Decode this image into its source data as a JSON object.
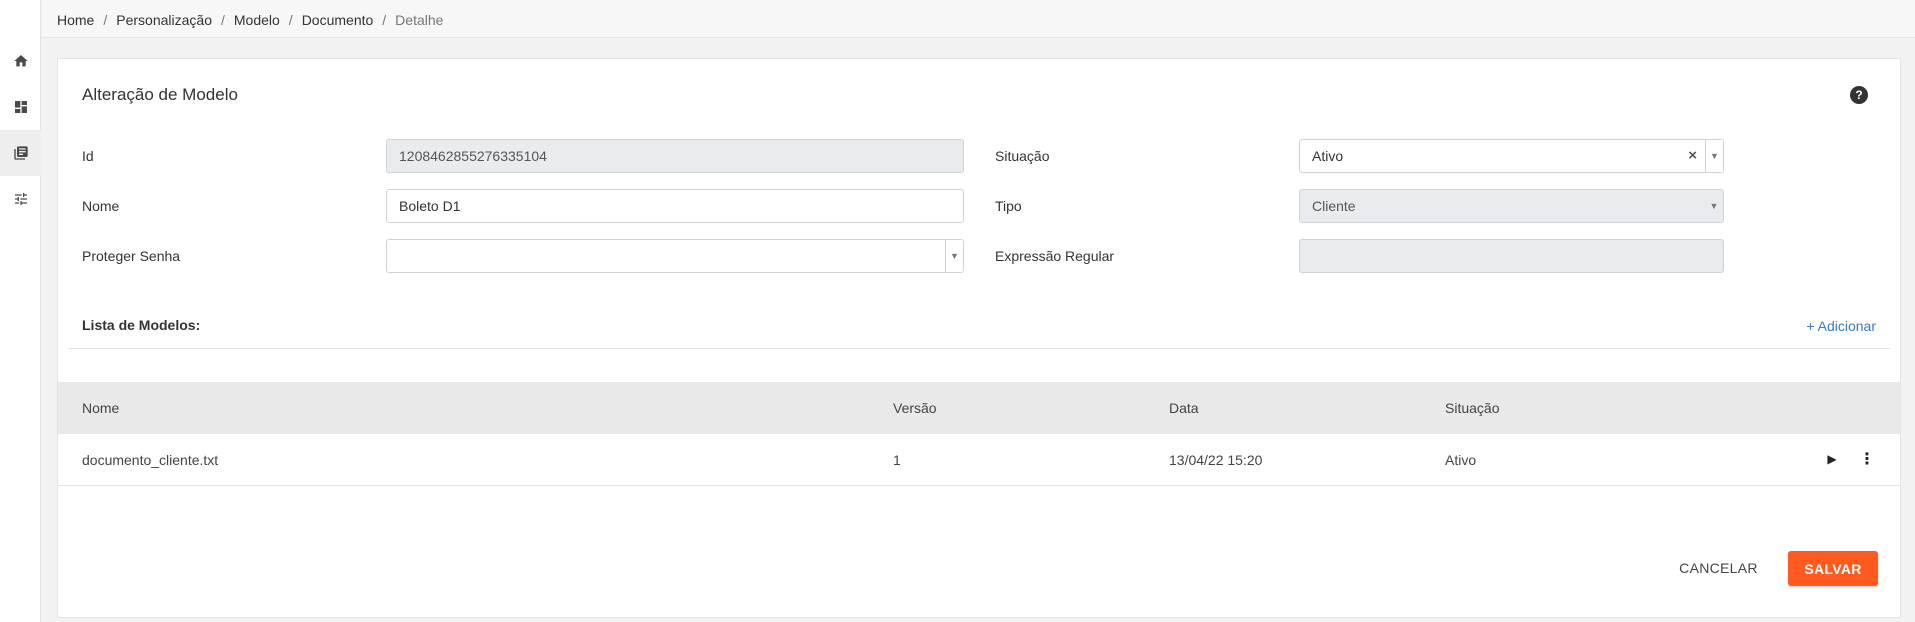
{
  "breadcrumb": {
    "items": [
      "Home",
      "Personalização",
      "Modelo",
      "Documento"
    ],
    "current": "Detalhe",
    "separator": "/"
  },
  "sidebar": {
    "items": [
      {
        "icon": "home-icon"
      },
      {
        "icon": "dashboard-icon"
      },
      {
        "icon": "library-icon",
        "active": true
      },
      {
        "icon": "tune-icon"
      }
    ]
  },
  "form": {
    "title": "Alteração de Modelo",
    "help_icon": "?",
    "id_label": "Id",
    "id_value": "1208462855276335104",
    "nome_label": "Nome",
    "nome_value": "Boleto D1",
    "proteger_label": "Proteger Senha",
    "proteger_value": "",
    "situacao_label": "Situação",
    "situacao_value": "Ativo",
    "tipo_label": "Tipo",
    "tipo_value": "Cliente",
    "expressao_label": "Expressão Regular",
    "expressao_value": ""
  },
  "list": {
    "title": "Lista de Modelos:",
    "add_label": "+ Adicionar",
    "columns": [
      "Nome",
      "Versão",
      "Data",
      "Situação"
    ],
    "rows": [
      {
        "nome": "documento_cliente.txt",
        "versao": "1",
        "data": "13/04/22 15:20",
        "situacao": "Ativo"
      }
    ]
  },
  "actions": {
    "cancel_label": "CANCELAR",
    "save_label": "SALVAR"
  },
  "colors": {
    "accent": "#ff5a1f",
    "link": "#3a7bbf"
  }
}
